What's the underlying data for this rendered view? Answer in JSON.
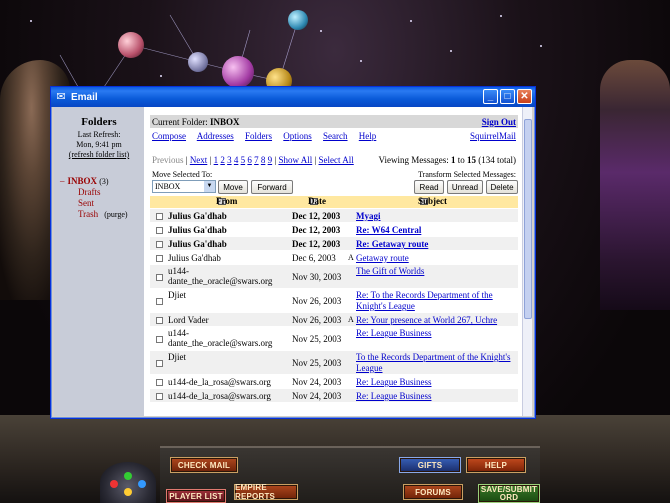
{
  "window": {
    "title": "Email",
    "controls": [
      "_",
      "□",
      "✕"
    ]
  },
  "folders": {
    "title": "Folders",
    "last_refresh_label": "Last Refresh:",
    "last_refresh_time": "Mon, 9:41 pm",
    "refresh_link": "(refresh folder list)",
    "inbox": {
      "label": "INBOX",
      "count": "(3)"
    },
    "subfolders": [
      {
        "label": "Drafts",
        "extra": ""
      },
      {
        "label": "Sent",
        "extra": ""
      },
      {
        "label": "Trash",
        "extra": "(purge)"
      }
    ]
  },
  "mail": {
    "current_folder_label": "Current Folder:",
    "current_folder": "INBOX",
    "sign_out": "Sign Out",
    "menu": [
      "Compose",
      "Addresses",
      "Folders",
      "Options",
      "Search",
      "Help"
    ],
    "brand_link": "SquirrelMail",
    "nav": {
      "previous": "Previous",
      "next": "Next",
      "pages": [
        "1",
        "2",
        "3",
        "4",
        "5",
        "6",
        "7",
        "8",
        "9"
      ],
      "show_all": "Show All",
      "select_all": "Select All",
      "viewing_prefix": "Viewing Messages:",
      "viewing_from": "1",
      "viewing_to": "15",
      "total": "(134 total)"
    },
    "move_label": "Move Selected To:",
    "move_target": "INBOX",
    "move_button": "Move",
    "forward_button": "Forward",
    "transform_label": "Transform Selected Messages:",
    "read_button": "Read",
    "unread_button": "Unread",
    "delete_button": "Delete",
    "columns": {
      "from": "From",
      "date": "Date",
      "subject": "Subject"
    },
    "messages": [
      {
        "from": "Julius Ga'dhab",
        "date": "Dec 12, 2003",
        "subject": "Myagi",
        "unread": true,
        "flag": ""
      },
      {
        "from": "Julius Ga'dhab",
        "date": "Dec 12, 2003",
        "subject": "Re: W64 Central",
        "unread": true,
        "flag": ""
      },
      {
        "from": "Julius Ga'dhab",
        "date": "Dec 12, 2003",
        "subject": "Re: Getaway route",
        "unread": true,
        "flag": ""
      },
      {
        "from": "Julius Ga'dhab",
        "date": "Dec 6, 2003",
        "subject": "Getaway route",
        "unread": false,
        "flag": "A"
      },
      {
        "from": "u144-dante_the_oracle@swars.org",
        "date": "Nov 30, 2003",
        "subject": "The Gift of Worlds",
        "unread": false,
        "flag": ""
      },
      {
        "from": "Djiet",
        "date": "Nov 26, 2003",
        "subject": "Re: To the Records Department of the Knight's League",
        "unread": false,
        "flag": ""
      },
      {
        "from": "Lord Vader",
        "date": "Nov 26, 2003",
        "subject": "Re: Your presence at World 267, Uchre",
        "unread": false,
        "flag": "A"
      },
      {
        "from": "u144-dante_the_oracle@swars.org",
        "date": "Nov 25, 2003",
        "subject": "Re: League Business",
        "unread": false,
        "flag": ""
      },
      {
        "from": "Djiet",
        "date": "Nov 25, 2003",
        "subject": "To the Records Department of the Knight's League",
        "unread": false,
        "flag": ""
      },
      {
        "from": "u144-de_la_rosa@swars.org",
        "date": "Nov 24, 2003",
        "subject": "Re: League Business",
        "unread": false,
        "flag": ""
      },
      {
        "from": "u144-de_la_rosa@swars.org",
        "date": "Nov 24, 2003",
        "subject": "Re: League Business",
        "unread": false,
        "flag": ""
      }
    ]
  },
  "game_buttons": {
    "check_mail": "CHECK MAIL",
    "gifts": "GIFTS",
    "help": "HELP",
    "player_list": "PLAYER LIST",
    "empire_reports": "EMPIRE REPORTS",
    "forums": "FORUMS",
    "save_submit": "SAVE/SUBMIT ORD"
  },
  "colors": {
    "titlebar": "#0a5ce4",
    "folder_pane": "#c8ccd8",
    "header_row": "#ffe8a0",
    "link": "#0000cc",
    "inbox_red": "#990000"
  }
}
